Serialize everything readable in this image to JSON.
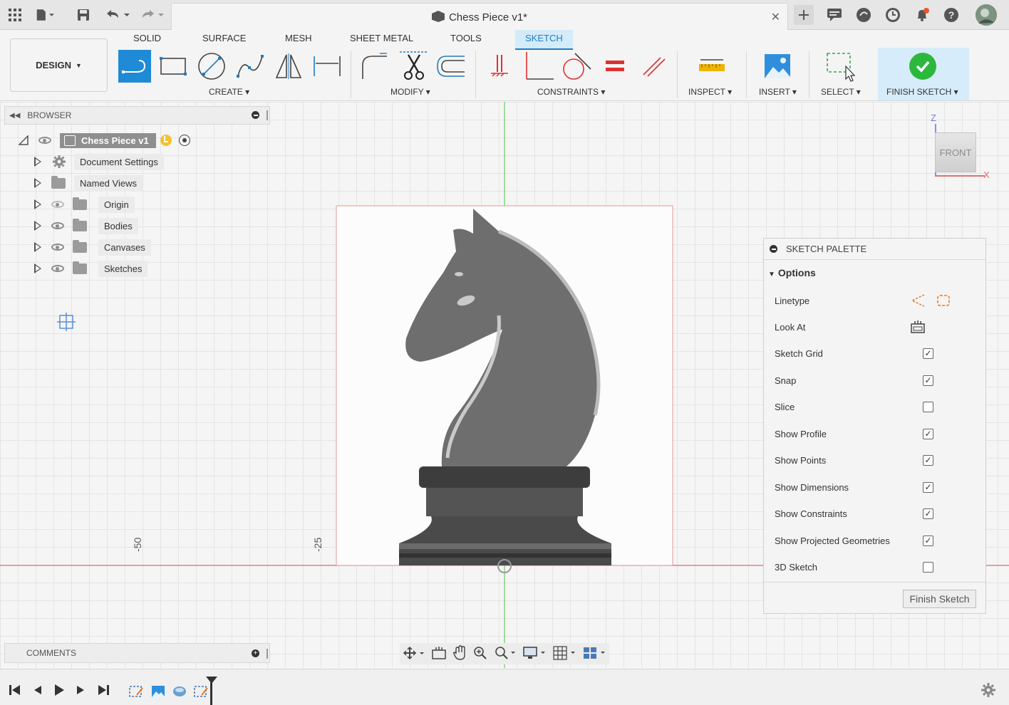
{
  "app": {
    "document_title": "Chess Piece v1*",
    "workspace": "DESIGN"
  },
  "ribbon_tabs": [
    "SOLID",
    "SURFACE",
    "MESH",
    "SHEET METAL",
    "TOOLS",
    "SKETCH"
  ],
  "active_tab": "SKETCH",
  "groups": {
    "create": "CREATE",
    "modify": "MODIFY",
    "constraints": "CONSTRAINTS",
    "inspect": "INSPECT",
    "insert": "INSERT",
    "select": "SELECT",
    "finish": "FINISH SKETCH"
  },
  "browser": {
    "title": "BROWSER",
    "root": "Chess Piece v1",
    "items": [
      "Document Settings",
      "Named Views",
      "Origin",
      "Bodies",
      "Canvases",
      "Sketches"
    ]
  },
  "viewcube": {
    "face": "FRONT",
    "axis_z": "Z",
    "axis_x": "X"
  },
  "rulers": [
    "-50",
    "-25"
  ],
  "palette": {
    "title": "SKETCH PALETTE",
    "section": "Options",
    "rows": [
      {
        "label": "Linetype",
        "type": "icons"
      },
      {
        "label": "Look At",
        "type": "icon"
      },
      {
        "label": "Sketch Grid",
        "checked": true
      },
      {
        "label": "Snap",
        "checked": true
      },
      {
        "label": "Slice",
        "checked": false
      },
      {
        "label": "Show Profile",
        "checked": true
      },
      {
        "label": "Show Points",
        "checked": true
      },
      {
        "label": "Show Dimensions",
        "checked": true
      },
      {
        "label": "Show Constraints",
        "checked": true
      },
      {
        "label": "Show Projected Geometries",
        "checked": true
      },
      {
        "label": "3D Sketch",
        "checked": false
      }
    ],
    "finish_button": "Finish Sketch"
  },
  "comments": {
    "title": "COMMENTS"
  },
  "colors": {
    "accent": "#1f7dc4",
    "finish_green": "#2db83d",
    "axis_red": "#e07070",
    "axis_green": "#66cc66"
  }
}
